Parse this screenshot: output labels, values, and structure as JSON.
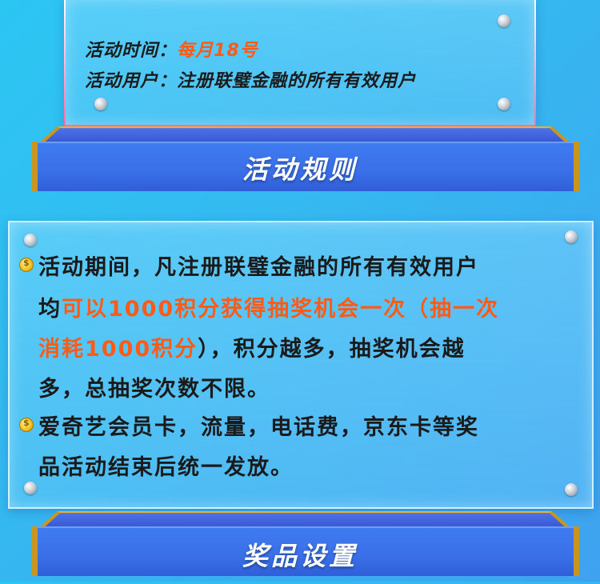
{
  "activity_info": {
    "time_label": "活动时间：",
    "time_value": "每月18号",
    "users_label": "活动用户：",
    "users_value": "注册联璧金融的所有有效用户"
  },
  "rules_banner": {
    "title": "活动规则"
  },
  "rules": {
    "item1": {
      "line1": "活动期间，凡注册联璧金融的所有有效用户",
      "line2_prefix": "均",
      "line2_highlight": "可以1000积分获得抽奖机会一次（抽一次",
      "line3_highlight": "消耗1000积分",
      "line3_suffix": "），积分越多，抽奖机会越",
      "line4": "多，总抽奖次数不限。"
    },
    "item2": {
      "line1": "爱奇艺会员卡，流量，电话费，京东卡等奖",
      "line2": "品活动结束后统一发放。"
    }
  },
  "prize_banner": {
    "title": "奖品设置"
  },
  "colors": {
    "highlight": "#ff5a16",
    "text": "#1a1a1a",
    "banner": "#3a6fe8",
    "gold_trim": "#c8961e"
  },
  "icons": {
    "bullet": "gold-coin-icon",
    "rivet": "rivet-icon"
  }
}
